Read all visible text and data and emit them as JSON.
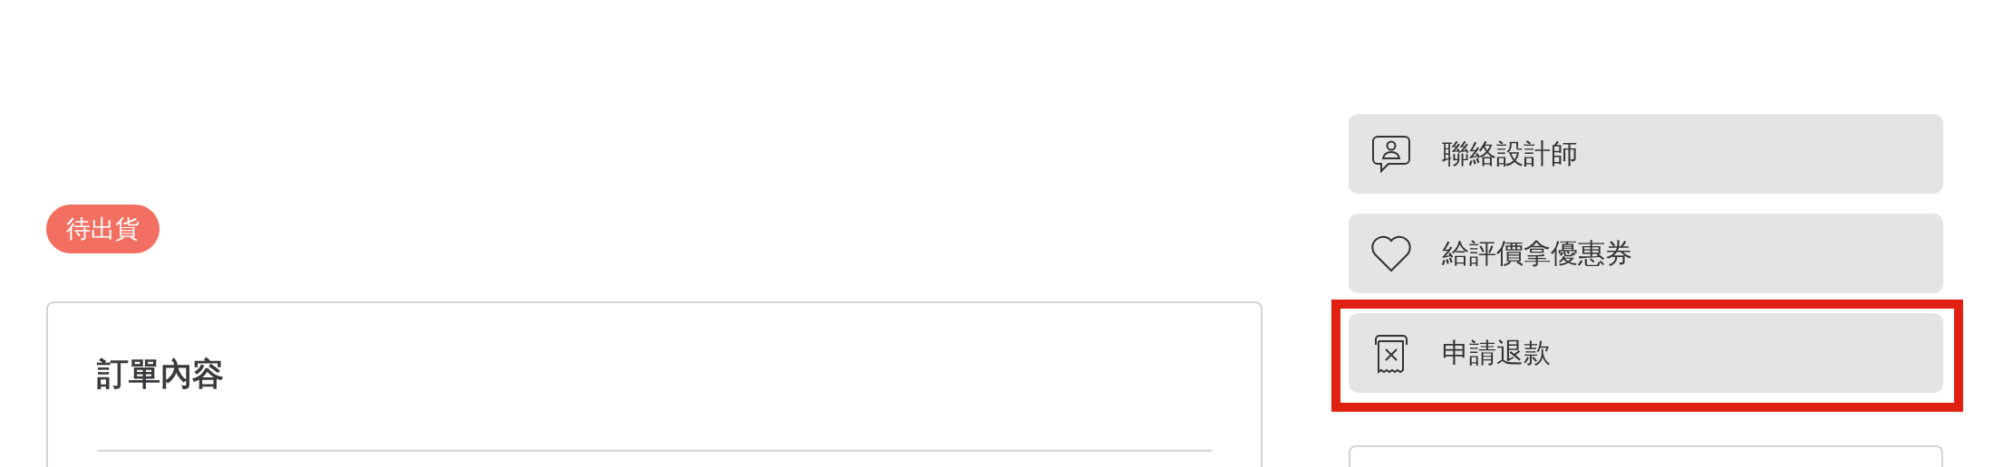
{
  "status_badge": {
    "label": "待出貨"
  },
  "order_card": {
    "title": "訂單內容"
  },
  "actions": [
    {
      "kind": "contact",
      "label": "聯絡設計師",
      "highlighted": false
    },
    {
      "kind": "review",
      "label": "給評價拿優惠券",
      "highlighted": false
    },
    {
      "kind": "refund",
      "label": "申請退款",
      "highlighted": true
    }
  ]
}
